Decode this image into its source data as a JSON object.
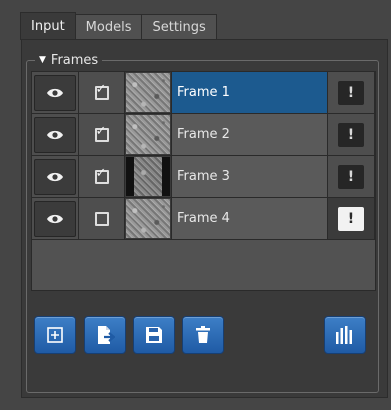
{
  "tabs": [
    {
      "label": "Input",
      "active": true
    },
    {
      "label": "Models",
      "active": false
    },
    {
      "label": "Settings",
      "active": false
    }
  ],
  "frames_group": {
    "title": "Frames",
    "rows": [
      {
        "name": "Frame 1",
        "visible": true,
        "checked": true,
        "selected": true,
        "comment_active": false,
        "thumb": "noise"
      },
      {
        "name": "Frame 2",
        "visible": true,
        "checked": true,
        "selected": false,
        "comment_active": false,
        "thumb": "noise"
      },
      {
        "name": "Frame 3",
        "visible": true,
        "checked": true,
        "selected": false,
        "comment_active": false,
        "thumb": "dark"
      },
      {
        "name": "Frame 4",
        "visible": true,
        "checked": false,
        "selected": false,
        "comment_active": true,
        "thumb": "noise"
      }
    ]
  },
  "toolbar": {
    "buttons": [
      {
        "name": "add-frame-button",
        "icon": "plus-box-icon"
      },
      {
        "name": "import-button",
        "icon": "import-file-icon"
      },
      {
        "name": "save-button",
        "icon": "floppy-disk-icon"
      },
      {
        "name": "delete-button",
        "icon": "trash-icon"
      },
      {
        "name": "histogram-button",
        "icon": "bar-chart-icon"
      }
    ]
  },
  "colors": {
    "selection": "#1c5a8f",
    "button_blue": "#2f6fb8",
    "panel_bg": "#3a3a3a"
  }
}
